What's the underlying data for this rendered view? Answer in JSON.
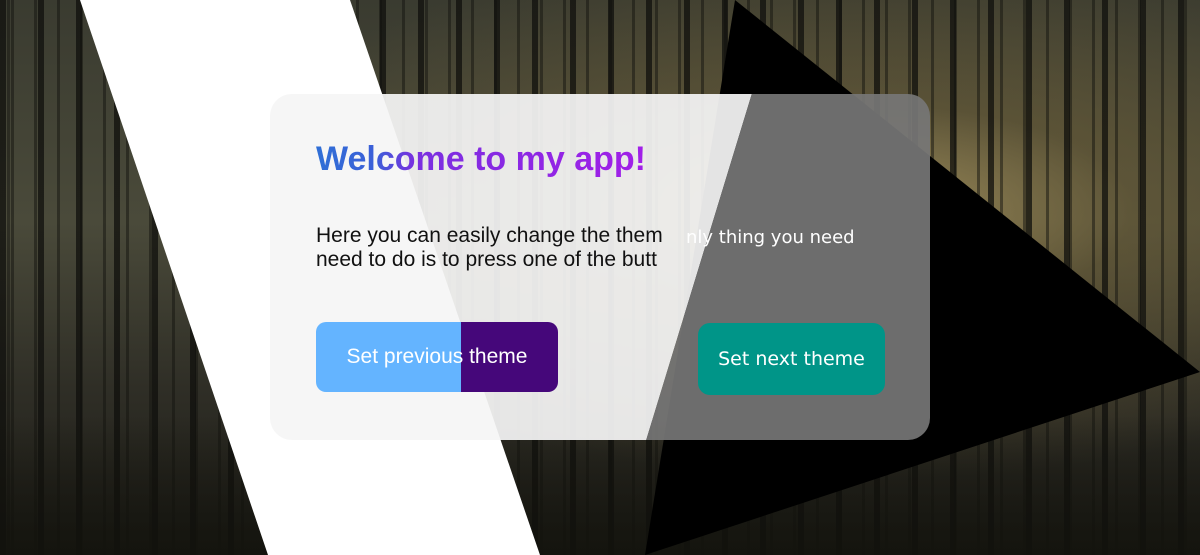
{
  "card": {
    "title": "Welcome to my app!",
    "message_primary": "Here you can easily change the them need to do is to press one of the butt",
    "message_overflow": "nly thing you need"
  },
  "buttons": {
    "previous_label": "Set previous theme",
    "next_label": "Set next theme"
  },
  "colors": {
    "title_start": "#2f6fd6",
    "title_end": "#a21fe8",
    "previous_button_light": "#64b4ff",
    "previous_button_dark": "#45077a",
    "next_button": "#009588"
  }
}
